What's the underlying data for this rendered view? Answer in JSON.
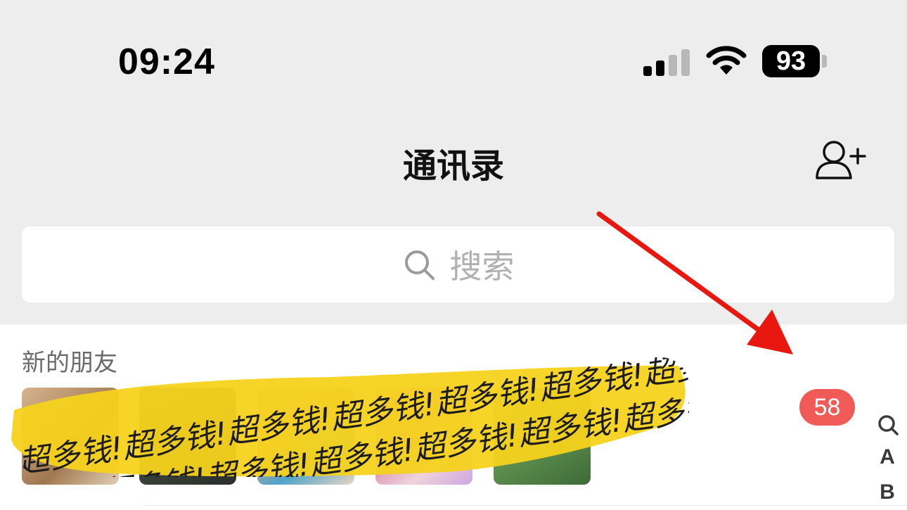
{
  "status_bar": {
    "time": "09:24",
    "battery": "93",
    "signal_icon": "cellular-signal-icon",
    "wifi_icon": "wifi-icon"
  },
  "nav": {
    "title": "通讯录",
    "add_contact_icon": "add-contact-icon"
  },
  "search": {
    "placeholder": "搜索",
    "icon": "search-icon"
  },
  "new_friends": {
    "title": "新的朋友",
    "badge_count": "58"
  },
  "overlay": {
    "scribble_text": "超多钱!超多钱!超多钱!超多钱!超多钱!超多钱!超多钱!超多钱!"
  },
  "index_bar": [
    "A",
    "B"
  ],
  "colors": {
    "background": "#ededed",
    "badge": "#f05a57",
    "scribble": "#f5d21c",
    "arrow": "#e8170f"
  }
}
